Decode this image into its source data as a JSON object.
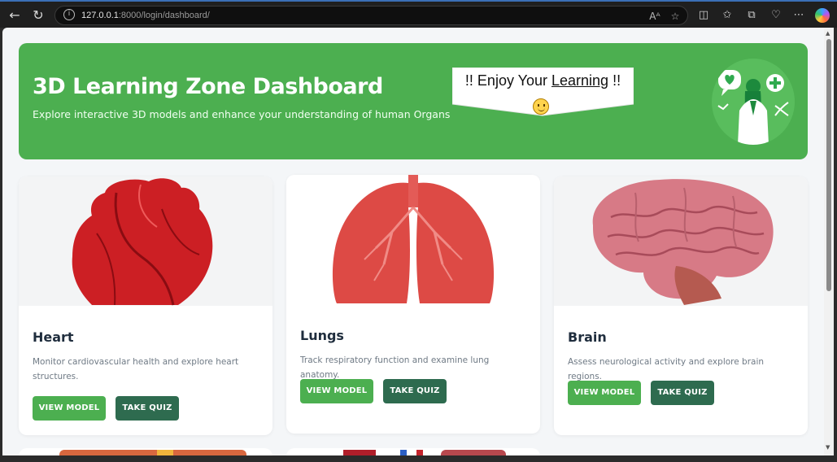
{
  "browser": {
    "url_host": "127.0.0.1",
    "url_path": ":8000/login/dashboard/"
  },
  "hero": {
    "title": "3D Learning Zone Dashboard",
    "subtitle": "Explore interactive 3D models and enhance your understanding of human Organs",
    "banner_prefix": "!! Enjoy Your ",
    "banner_link": "Learning",
    "banner_suffix": " !!"
  },
  "cards": [
    {
      "title": "Heart",
      "description": "Monitor cardiovascular health and explore heart structures.",
      "view_label": "VIEW MODEL",
      "quiz_label": "TAKE QUIZ"
    },
    {
      "title": "Lungs",
      "description": "Track respiratory function and examine lung anatomy.",
      "view_label": "VIEW MODEL",
      "quiz_label": "TAKE QUIZ"
    },
    {
      "title": "Brain",
      "description": "Assess neurological activity and explore brain regions.",
      "view_label": "VIEW MODEL",
      "quiz_label": "TAKE QUIZ"
    }
  ],
  "colors": {
    "primary_green": "#4caf50",
    "dark_green": "#2e6b4f"
  }
}
